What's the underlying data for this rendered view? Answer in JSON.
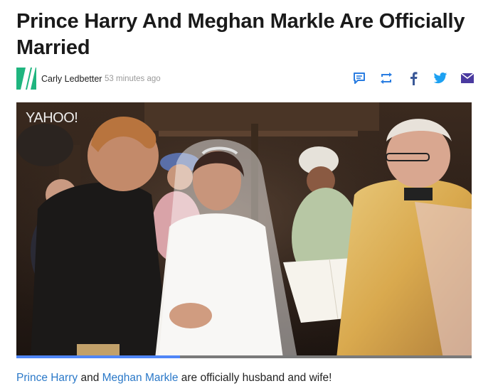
{
  "article": {
    "headline": "Prince Harry And Meghan Markle Are Officially Married",
    "author": "Carly Ledbetter",
    "time": "53 minutes ago"
  },
  "share": [
    {
      "name": "comment-icon",
      "color": "#2a7de1"
    },
    {
      "name": "retweet-icon",
      "color": "#2a7de1"
    },
    {
      "name": "facebook-icon",
      "color": "#3b5998"
    },
    {
      "name": "twitter-icon",
      "color": "#1da1f2"
    },
    {
      "name": "email-icon",
      "color": "#4a3aa0"
    }
  ],
  "video": {
    "watermark": "YAHOO!",
    "progress": 0.36
  },
  "caption": {
    "link1": "Prince Harry",
    "and": " and ",
    "link2": "Meghan Markle",
    "rest": " are officially husband and wife!"
  },
  "colors": {
    "accent": "#2a78c8",
    "avatar_bg": "#1fb57f",
    "progress": "#4f86f7"
  }
}
